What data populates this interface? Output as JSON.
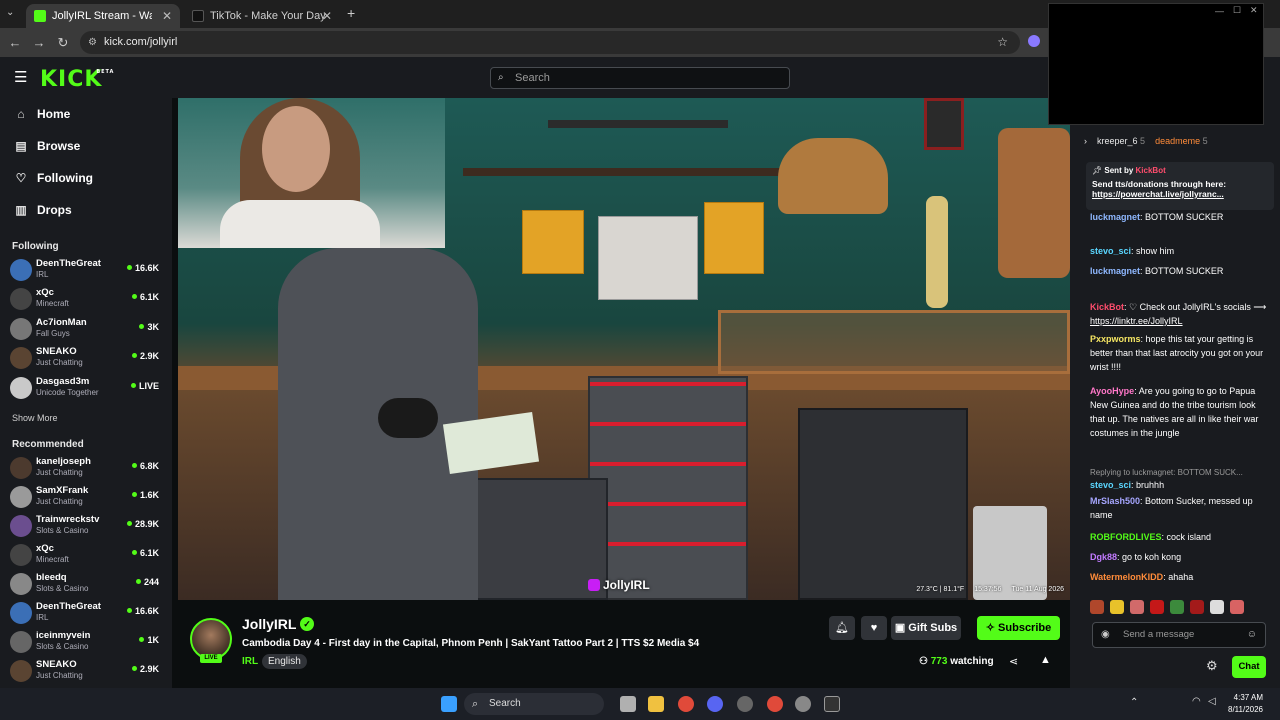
{
  "browser": {
    "tabs": [
      {
        "label": "JollyIRL Stream - Watch Liv",
        "active": true
      },
      {
        "label": "TikTok - Make Your Day",
        "active": false
      }
    ],
    "url": "kick.com/jollyirl"
  },
  "kick": {
    "logo": "KICK",
    "logo_sup": "BETA",
    "search_placeholder": "Search"
  },
  "sidebar": {
    "nav": [
      {
        "label": "Home",
        "icon": "home-icon"
      },
      {
        "label": "Browse",
        "icon": "browse-icon"
      },
      {
        "label": "Following",
        "icon": "heart-icon"
      },
      {
        "label": "Drops",
        "icon": "drops-icon"
      }
    ],
    "following_title": "Following",
    "following": [
      {
        "name": "DeenTheGreat",
        "category": "IRL",
        "viewers": "16.6K",
        "color": "#3b6fb6"
      },
      {
        "name": "xQc",
        "category": "Minecraft",
        "viewers": "6.1K",
        "color": "#444444"
      },
      {
        "name": "Ac7ionMan",
        "category": "Fall Guys",
        "viewers": "3K",
        "color": "#777777"
      },
      {
        "name": "SNEAKO",
        "category": "Just Chatting",
        "viewers": "2.9K",
        "color": "#5a4432"
      },
      {
        "name": "Dasgasd3m",
        "category": "Unicode Together",
        "viewers": "LIVE",
        "color": "#c9c9c9"
      }
    ],
    "show_more": "Show More",
    "recommended_title": "Recommended",
    "recommended": [
      {
        "name": "kaneljoseph",
        "category": "Just Chatting",
        "viewers": "6.8K",
        "color": "#4c3a2e"
      },
      {
        "name": "SamXFrank",
        "category": "Just Chatting",
        "viewers": "1.6K",
        "color": "#9a9a9a"
      },
      {
        "name": "Trainwreckstv",
        "category": "Slots & Casino",
        "viewers": "28.9K",
        "color": "#6b4e8f"
      },
      {
        "name": "xQc",
        "category": "Minecraft",
        "viewers": "6.1K",
        "color": "#444444"
      },
      {
        "name": "bleedq",
        "category": "Slots & Casino",
        "viewers": "244",
        "color": "#888888"
      },
      {
        "name": "DeenTheGreat",
        "category": "IRL",
        "viewers": "16.6K",
        "color": "#3b6fb6"
      },
      {
        "name": "iceinmyvein",
        "category": "Slots & Casino",
        "viewers": "1K",
        "color": "#666666"
      },
      {
        "name": "SNEAKO",
        "category": "Just Chatting",
        "viewers": "2.9K",
        "color": "#5a4432"
      }
    ]
  },
  "video": {
    "watermark": "JollyIRL",
    "hud": [
      "27.3°C | 81.1°F",
      "15:37:56",
      "Tue 11 Aug 2026"
    ]
  },
  "stream": {
    "streamer": "JollyIRL",
    "live_badge": "LIVE",
    "title": "Cambodia Day 4 - First day in the Capital, Phnom Penh | SakYant Tattoo Part 2 | TTS $2 Media $4",
    "category": "IRL",
    "language": "English",
    "gift_label": "Gift Subs",
    "subscribe_label": "Subscribe",
    "viewers": "773",
    "watching_label": "watching"
  },
  "chat": {
    "leaderboard": [
      {
        "name": "kreeper_6",
        "count": "5"
      },
      {
        "name": "deadmeme",
        "count": "5"
      }
    ],
    "pinned": {
      "sent_by": "Sent by",
      "bot": "KickBot",
      "text": "Send tts/donations through here:",
      "link": "https://powerchat.live/jollyranc..."
    },
    "messages": [
      {
        "user": "luckmagnet",
        "color": "#8fb8ff",
        "text": "BOTTOM SUCKER"
      },
      {
        "user": "stevo_sci",
        "color": "#5ad6ff",
        "text": "show him"
      },
      {
        "user": "luckmagnet",
        "color": "#8fb8ff",
        "text": "BOTTOM SUCKER"
      },
      {
        "user": "KickBot",
        "color": "#ff4d6d",
        "text": "♡ Check out JollyIRL's socials ⟶",
        "link": "https://linktr.ee/JollyIRL"
      },
      {
        "user": "Pxxpworms",
        "color": "#f5e663",
        "text": "hope this tat your getting is better than that last atrocity you got on your wrist !!!!"
      },
      {
        "user": "AyooHype",
        "color": "#ff77c8",
        "text": "Are you going to go to Papua New Guinea and do the tribe tourism look that up. The natives are all in like their war costumes in the jungle"
      },
      {
        "user": "stevo_sci",
        "color": "#5ad6ff",
        "text": "bruhhh",
        "reply": "Replying to luckmagnet: BOTTOM SUCK..."
      },
      {
        "user": "MrSlash500",
        "color": "#a6a6ff",
        "text": "Bottom Sucker, messed up name"
      },
      {
        "user": "ROBFORDLIVES",
        "color": "#53fc18",
        "text": "cock island"
      },
      {
        "user": "Dgk88",
        "color": "#c27bff",
        "text": "go to koh kong"
      },
      {
        "user": "WatermelonKIDD",
        "color": "#ff8c3a",
        "text": "ahaha"
      }
    ],
    "input_placeholder": "Send a message",
    "chat_button": "Chat"
  },
  "taskbar": {
    "search": "Search",
    "time": "4:37 AM",
    "date": "8/11/2026"
  }
}
